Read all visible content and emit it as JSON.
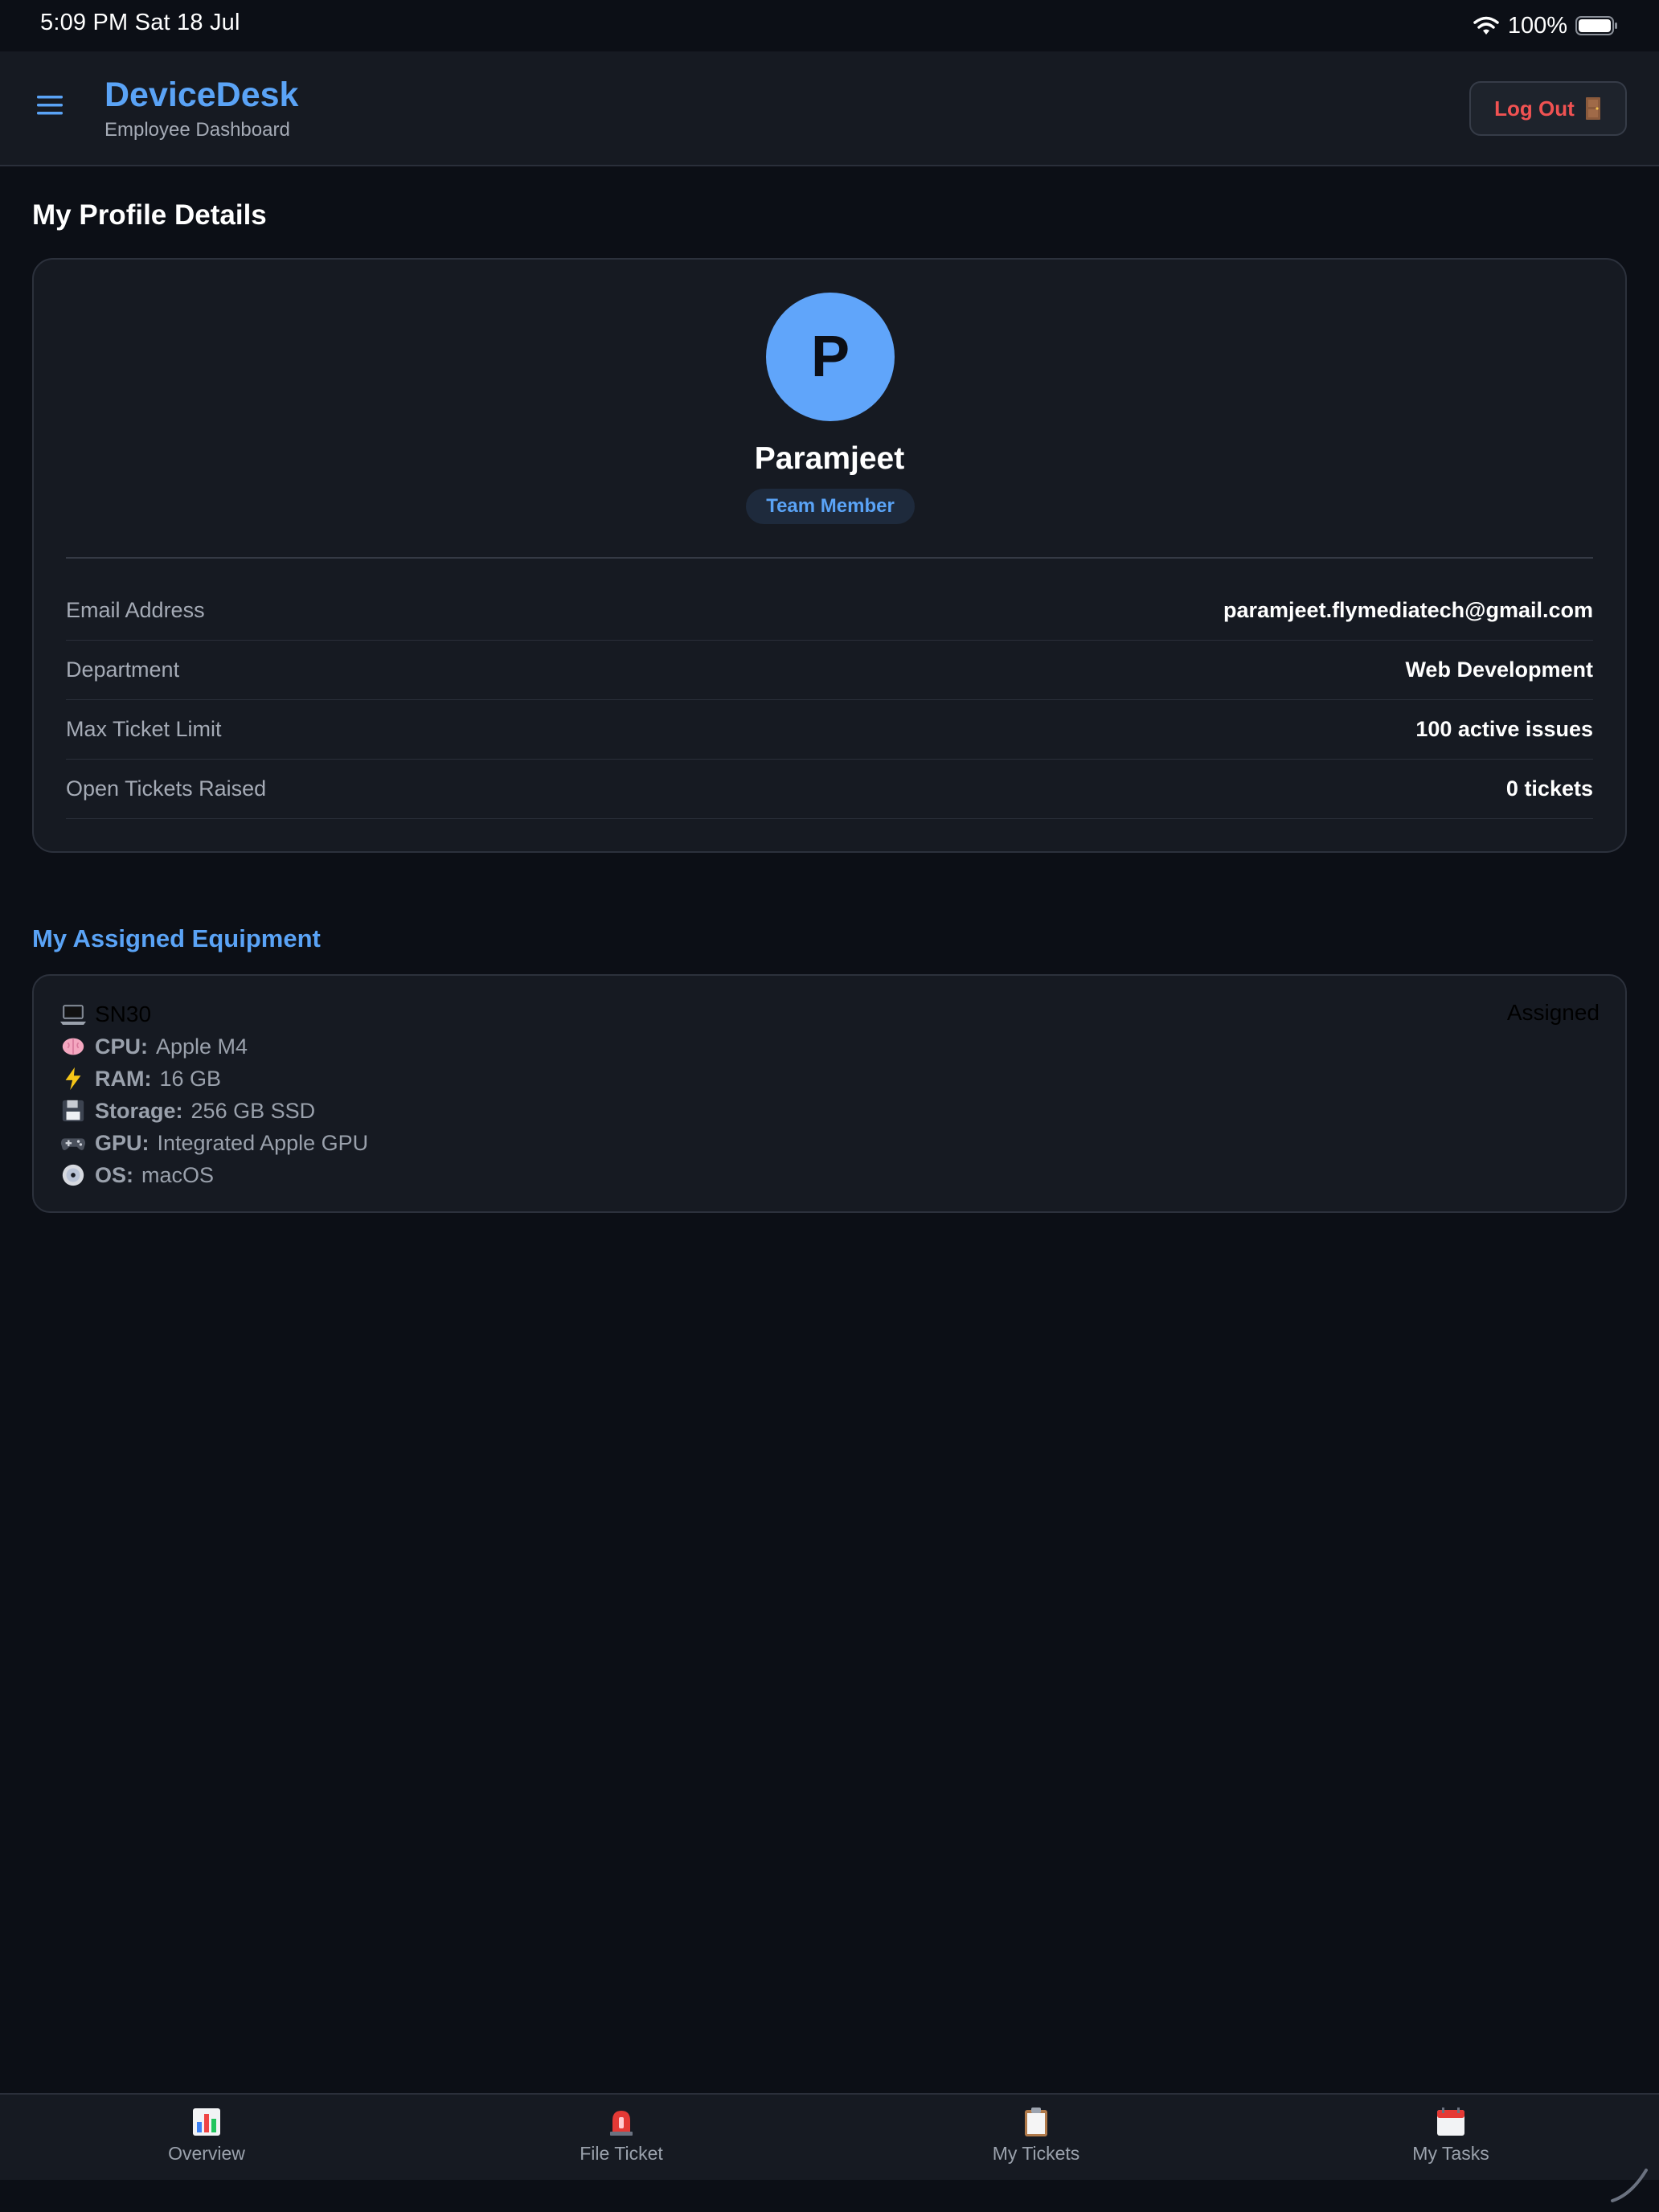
{
  "status_bar": {
    "time": "5:09 PM   Sat 18 Jul",
    "battery": "100%"
  },
  "header": {
    "title": "DeviceDesk",
    "subtitle": "Employee Dashboard",
    "logout_label": "Log Out"
  },
  "profile": {
    "section_title": "My Profile Details",
    "avatar_initial": "P",
    "name": "Paramjeet",
    "role": "Team Member",
    "details": [
      {
        "label": "Email Address",
        "value": "paramjeet.flymediatech@gmail.com"
      },
      {
        "label": "Department",
        "value": "Web Development"
      },
      {
        "label": "Max Ticket Limit",
        "value": "100 active issues"
      },
      {
        "label": "Open Tickets Raised",
        "value": "0 tickets"
      }
    ]
  },
  "equipment": {
    "section_title": "My Assigned Equipment",
    "serial": "SN30",
    "status": "Assigned",
    "specs": [
      {
        "icon": "brain-icon",
        "key": "CPU:",
        "value": "Apple M4"
      },
      {
        "icon": "lightning-icon",
        "key": "RAM:",
        "value": "16 GB"
      },
      {
        "icon": "floppy-disk-icon",
        "key": "Storage:",
        "value": "256 GB SSD"
      },
      {
        "icon": "game-controller-icon",
        "key": "GPU:",
        "value": "Integrated Apple GPU"
      },
      {
        "icon": "disc-icon",
        "key": "OS:",
        "value": "macOS"
      }
    ]
  },
  "bottom_nav": {
    "items": [
      {
        "label": "Overview",
        "icon": "bar-chart-icon"
      },
      {
        "label": "File Ticket",
        "icon": "siren-icon"
      },
      {
        "label": "My Tickets",
        "icon": "clipboard-icon"
      },
      {
        "label": "My Tasks",
        "icon": "calendar-icon"
      }
    ]
  },
  "colors": {
    "background": "#0c0f16",
    "surface": "#161a22",
    "accent": "#5aa3f6",
    "danger": "#f05252"
  }
}
